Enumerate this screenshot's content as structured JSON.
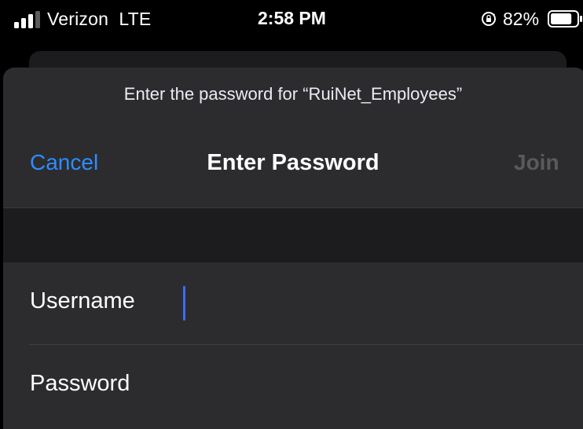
{
  "status_bar": {
    "carrier": "Verizon",
    "network": "LTE",
    "time": "2:58 PM",
    "battery_percent": "82%",
    "battery_level": 0.82,
    "signal_bars": 3,
    "signal_bars_total": 4,
    "icons": [
      "signal-icon",
      "rotation-lock-icon",
      "battery-icon"
    ]
  },
  "dialog": {
    "prompt": "Enter the password for “RuiNet_Employees”",
    "title": "Enter Password",
    "cancel_label": "Cancel",
    "join_label": "Join",
    "fields": [
      {
        "label": "Username",
        "value": "",
        "placeholder": ""
      },
      {
        "label": "Password",
        "value": "",
        "placeholder": ""
      }
    ]
  },
  "colors": {
    "accent": "#2f8cff",
    "disabled": "#5a5a5e",
    "caret": "#3b6cf6",
    "sheet": "#2c2c2e",
    "background": "#000000"
  }
}
